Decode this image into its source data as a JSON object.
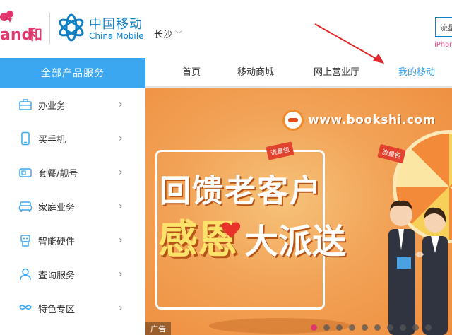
{
  "header": {
    "logo_he_text": "and和",
    "brand_cn": "中国移动",
    "brand_en": "China Mobile",
    "city": "长沙",
    "search_text": "流星",
    "search_hint": "iPhone"
  },
  "nav": {
    "all_services": "全部产品服务",
    "links": [
      "首页",
      "移动商城",
      "网上营业厅",
      "我的移动"
    ],
    "active_index": 3
  },
  "sidebar": {
    "items": [
      {
        "label": "办业务",
        "icon": "briefcase-icon"
      },
      {
        "label": "买手机",
        "icon": "phone-icon"
      },
      {
        "label": "套餐/靓号",
        "icon": "sim-card-icon"
      },
      {
        "label": "家庭业务",
        "icon": "sofa-icon"
      },
      {
        "label": "智能硬件",
        "icon": "robot-icon"
      },
      {
        "label": "查询服务",
        "icon": "user-icon"
      },
      {
        "label": "特色专区",
        "icon": "mustache-icon"
      }
    ]
  },
  "banner": {
    "watermark": "www.bookshi.com",
    "headline_1": "回馈老客户",
    "headline_2a": "感恩",
    "headline_2b": "大派送",
    "tag_1": "流量包",
    "tag_2": "流量包",
    "ad_label": "广告",
    "slides_total": 10,
    "active_slide": 0
  },
  "colors": {
    "brand_blue": "#0f7fc4",
    "nav_blue": "#3aa7f0",
    "pink": "#e0366e",
    "banner_orange": "#f2a357"
  }
}
